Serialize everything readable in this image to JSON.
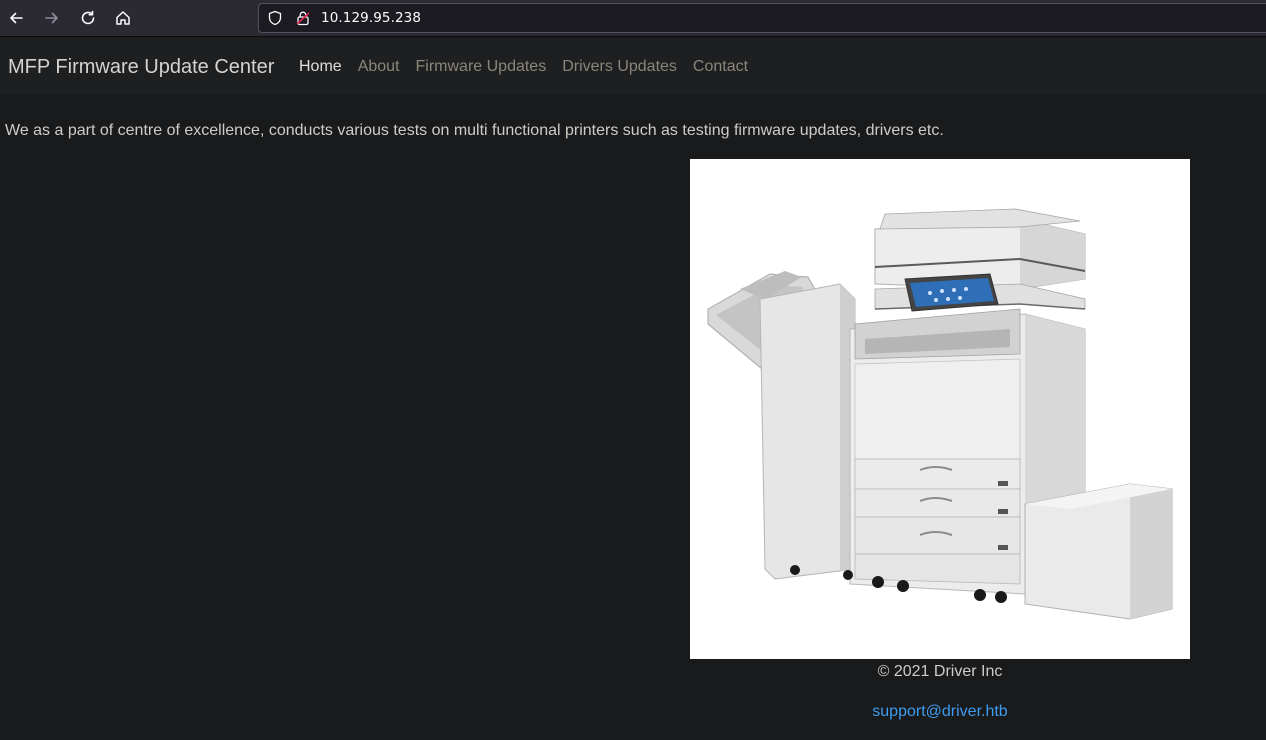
{
  "browser": {
    "url": "10.129.95.238",
    "icons": [
      "back-icon",
      "forward-icon",
      "reload-icon",
      "home-icon",
      "shield-icon",
      "lock-icon"
    ]
  },
  "navbar": {
    "brand": "MFP Firmware Update Center",
    "links": [
      {
        "label": "Home",
        "active": true
      },
      {
        "label": "About",
        "active": false
      },
      {
        "label": "Firmware Updates",
        "active": false
      },
      {
        "label": "Drivers Updates",
        "active": false
      },
      {
        "label": "Contact",
        "active": false
      }
    ]
  },
  "main": {
    "intro": "We as a part of centre of excellence, conducts various tests on multi functional printers such as testing firmware updates, drivers etc.",
    "footer": {
      "copyright": "© 2021 Driver Inc",
      "email": "support@driver.htb"
    }
  },
  "colors": {
    "page_background": "#181a1b",
    "navbar_background": "#1d1f21",
    "link_accent": "#3d9cf0",
    "nav_inactive": "#8c857a",
    "nav_active": "#e0ddd8"
  }
}
